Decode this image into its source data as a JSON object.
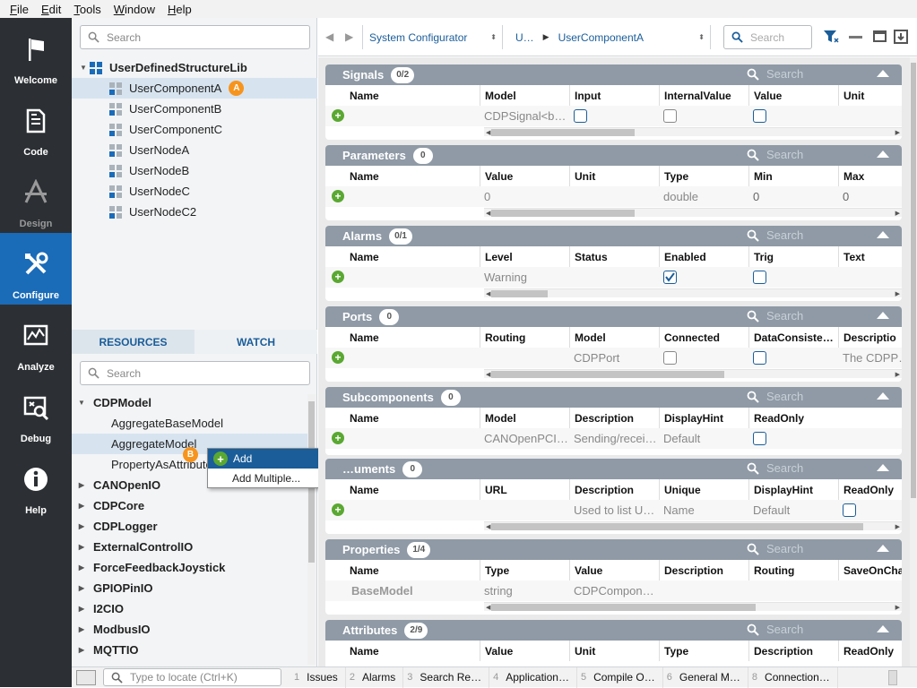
{
  "menu": [
    {
      "u": "F",
      "rest": "ile"
    },
    {
      "u": "E",
      "rest": "dit"
    },
    {
      "u": "T",
      "rest": "ools"
    },
    {
      "u": "W",
      "rest": "indow"
    },
    {
      "u": "H",
      "rest": "elp"
    }
  ],
  "nav": [
    {
      "label": "Welcome",
      "icon": "flag-icon"
    },
    {
      "label": "Code",
      "icon": "document-icon"
    },
    {
      "label": "Design",
      "icon": "design-icon"
    },
    {
      "label": "Configure",
      "icon": "tools-icon"
    },
    {
      "label": "Analyze",
      "icon": "chart-icon"
    },
    {
      "label": "Debug",
      "icon": "debug-icon"
    },
    {
      "label": "Help",
      "icon": "info-icon"
    }
  ],
  "tree": {
    "search_placeholder": "Search",
    "root": "UserDefinedStructureLib",
    "items": [
      "UserComponentA",
      "UserComponentB",
      "UserComponentC",
      "UserNodeA",
      "UserNodeB",
      "UserNodeC",
      "UserNodeC2"
    ],
    "badge_a": "A"
  },
  "lower_tabs": {
    "resources": "RESOURCES",
    "watch": "WATCH"
  },
  "resources": {
    "search_placeholder": "Search",
    "root": "CDPModel",
    "children": [
      "AggregateBaseModel",
      "AggregateModel",
      "PropertyAsAttribute"
    ],
    "others": [
      "CANOpenIO",
      "CDPCore",
      "CDPLogger",
      "ExternalControlIO",
      "ForceFeedbackJoystick",
      "GPIOPinIO",
      "I2CIO",
      "ModbusIO",
      "MQTTIO"
    ],
    "badge_b": "B"
  },
  "context_menu": {
    "add": "Add",
    "add_multiple": "Add Multiple..."
  },
  "topbar": {
    "configurator": "System Configurator",
    "crumb1": "U…",
    "crumb2": "UserComponentA",
    "search_placeholder": "Search"
  },
  "sections": {
    "signals": {
      "title": "Signals",
      "count": "0/2",
      "search": "Search",
      "cols": [
        "Name",
        "Model",
        "Input",
        "InternalValue",
        "Value",
        "Unit"
      ],
      "row": {
        "model": "CDPSignal<b…"
      }
    },
    "parameters": {
      "title": "Parameters",
      "count": "0",
      "search": "Search",
      "cols": [
        "Name",
        "Value",
        "Unit",
        "Type",
        "Min",
        "Max"
      ],
      "row": {
        "value": "0",
        "type": "double",
        "min": "0",
        "max": "0"
      }
    },
    "alarms": {
      "title": "Alarms",
      "count": "0/1",
      "search": "Search",
      "cols": [
        "Name",
        "Level",
        "Status",
        "Enabled",
        "Trig",
        "Text"
      ],
      "row": {
        "level": "Warning",
        "enabled": true
      }
    },
    "ports": {
      "title": "Ports",
      "count": "0",
      "search": "Search",
      "cols": [
        "Name",
        "Routing",
        "Model",
        "Connected",
        "DataConsiste…",
        "Descriptio"
      ],
      "row": {
        "model": "CDPPort",
        "description": "The CDPP…"
      }
    },
    "subcomponents": {
      "title": "Subcomponents",
      "count": "0",
      "search": "Search",
      "cols": [
        "Name",
        "Model",
        "Description",
        "DisplayHint",
        "ReadOnly"
      ],
      "row": {
        "model": "CANOpenPCI…",
        "description": "Sending/recei…",
        "displayhint": "Default"
      }
    },
    "documents": {
      "title": "…uments",
      "count": "0",
      "search": "Search",
      "cols": [
        "Name",
        "URL",
        "Description",
        "Unique",
        "DisplayHint",
        "ReadOnly"
      ],
      "row": {
        "description": "Used to list U…",
        "unique": "Name",
        "displayhint": "Default"
      }
    },
    "properties": {
      "title": "Properties",
      "count": "1/4",
      "search": "Search",
      "cols": [
        "Name",
        "Type",
        "Value",
        "Description",
        "Routing",
        "SaveOnCha"
      ],
      "row": {
        "name": "BaseModel",
        "type": "string",
        "value": "CDPCompon…"
      }
    },
    "attributes": {
      "title": "Attributes",
      "count": "2/9",
      "search": "Search",
      "cols": [
        "Name",
        "Value",
        "Unit",
        "Type",
        "Description",
        "ReadOnly"
      ]
    }
  },
  "statusbar": {
    "locate_placeholder": "Type to locate (Ctrl+K)",
    "tabs": [
      {
        "n": "1",
        "label": "Issues"
      },
      {
        "n": "2",
        "label": "Alarms"
      },
      {
        "n": "3",
        "label": "Search Re…"
      },
      {
        "n": "4",
        "label": "Application…"
      },
      {
        "n": "5",
        "label": "Compile O…"
      },
      {
        "n": "6",
        "label": "General M…"
      },
      {
        "n": "8",
        "label": "Connection…"
      }
    ]
  },
  "colors": {
    "nav_bg": "#2c3034",
    "nav_active": "#1a6bb8",
    "section_header": "#8f9aa6",
    "accent": "#1a5d99",
    "badge": "#f7941d",
    "add_green": "#5aa832"
  }
}
